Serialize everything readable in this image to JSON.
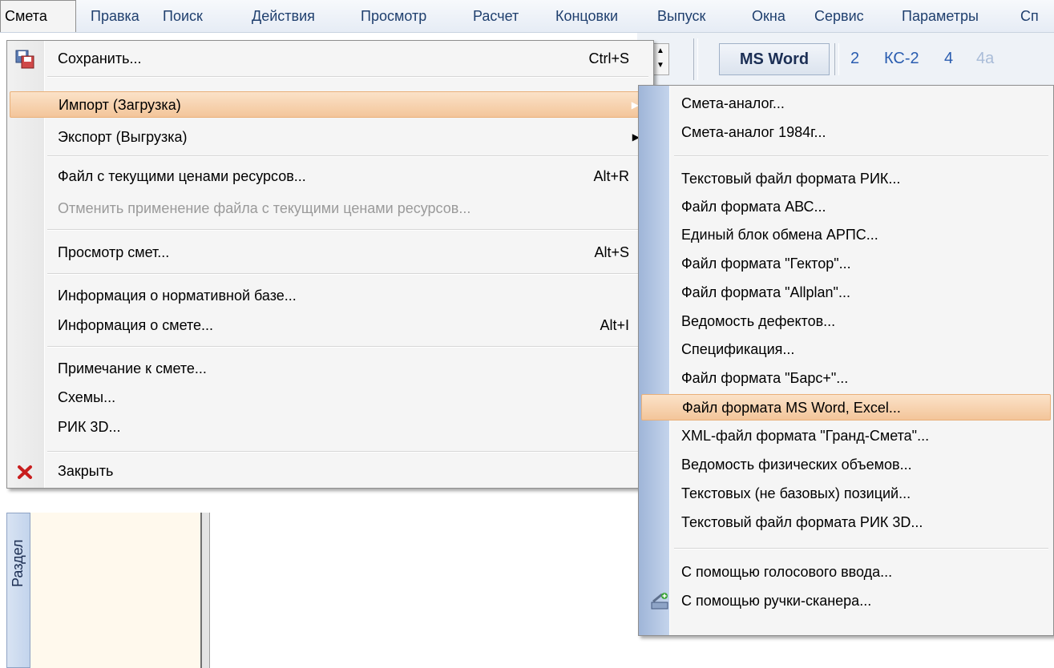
{
  "menubar": {
    "items": [
      "Смета",
      "Правка",
      "Поиск",
      "Действия",
      "Просмотр",
      "Расчет",
      "Концовки",
      "Выпуск",
      "Окна",
      "Сервис",
      "Параметры",
      "Сп"
    ]
  },
  "toolbar": {
    "tabs": [
      "MS Word",
      "2",
      "КС-2",
      "4",
      "4а"
    ]
  },
  "left_panel": {
    "vertical_tab": "Раздел"
  },
  "smeta_menu": {
    "items": [
      {
        "label": "Сохранить...",
        "shortcut": "Ctrl+S",
        "icon": "save-icon"
      },
      {
        "label": "Импорт (Загрузка)",
        "submenu": true,
        "highlighted": true
      },
      {
        "label": "Экспорт (Выгрузка)",
        "submenu": true
      },
      {
        "label": "Файл с текущими ценами ресурсов...",
        "shortcut": "Alt+R"
      },
      {
        "label": "Отменить применение файла с текущими ценами ресурсов...",
        "disabled": true
      },
      {
        "label": "Просмотр смет...",
        "shortcut": "Alt+S"
      },
      {
        "label": "Информация о нормативной базе..."
      },
      {
        "label": "Информация о смете...",
        "shortcut": "Alt+I"
      },
      {
        "label": "Примечание к смете..."
      },
      {
        "label": "Схемы..."
      },
      {
        "label": "РИК 3D..."
      },
      {
        "label": "Закрыть",
        "icon": "close-icon"
      }
    ],
    "arrow": "▶"
  },
  "import_submenu": {
    "items": [
      "Смета-аналог...",
      "Смета-аналог 1984г...",
      "Текстовый файл формата РИК...",
      "Файл формата АВС...",
      "Единый блок обмена АРПС...",
      "Файл формата \"Гектор\"...",
      "Файл формата \"Allplan\"...",
      "Ведомость дефектов...",
      "Спецификация...",
      "Файл формата \"Барс+\"...",
      "Файл формата MS Word, Excel...",
      "XML-файл формата \"Гранд-Смета\"...",
      "Ведомость физических объемов...",
      "Текстовых (не базовых) позиций...",
      "Текстовый файл формата РИК 3D...",
      "С помощью голосового ввода...",
      "С помощью ручки-сканера..."
    ],
    "highlighted_index": 10
  }
}
